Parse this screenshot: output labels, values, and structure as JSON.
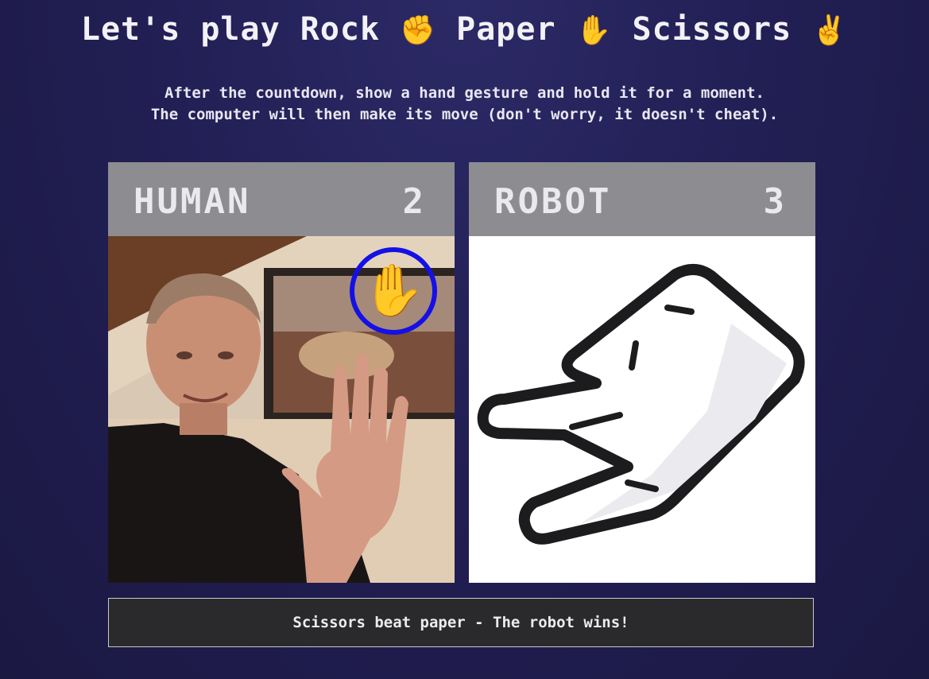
{
  "title": {
    "prefix": "Let's play Rock",
    "rock_emoji": "✊",
    "paper_word": "Paper",
    "paper_emoji": "✋",
    "scissors_word": "Scissors",
    "scissors_emoji": "✌️"
  },
  "instructions": {
    "line1": "After the countdown, show a hand gesture and hold it for a moment.",
    "line2": "The computer will then make its move (don't worry, it doesn't cheat)."
  },
  "human": {
    "name": "HUMAN",
    "score": "2",
    "detected_gesture_emoji": "✋",
    "detected_gesture_icon": "paper-hand-icon"
  },
  "robot": {
    "name": "ROBOT",
    "score": "3",
    "move_icon": "scissors-hand-icon"
  },
  "result": {
    "message": "Scissors beat paper - The robot wins!"
  },
  "colors": {
    "background": "#221f55",
    "panel_header": "#8d8c91",
    "detection_ring": "#1410e6",
    "result_bar": "#2a2a2c"
  }
}
